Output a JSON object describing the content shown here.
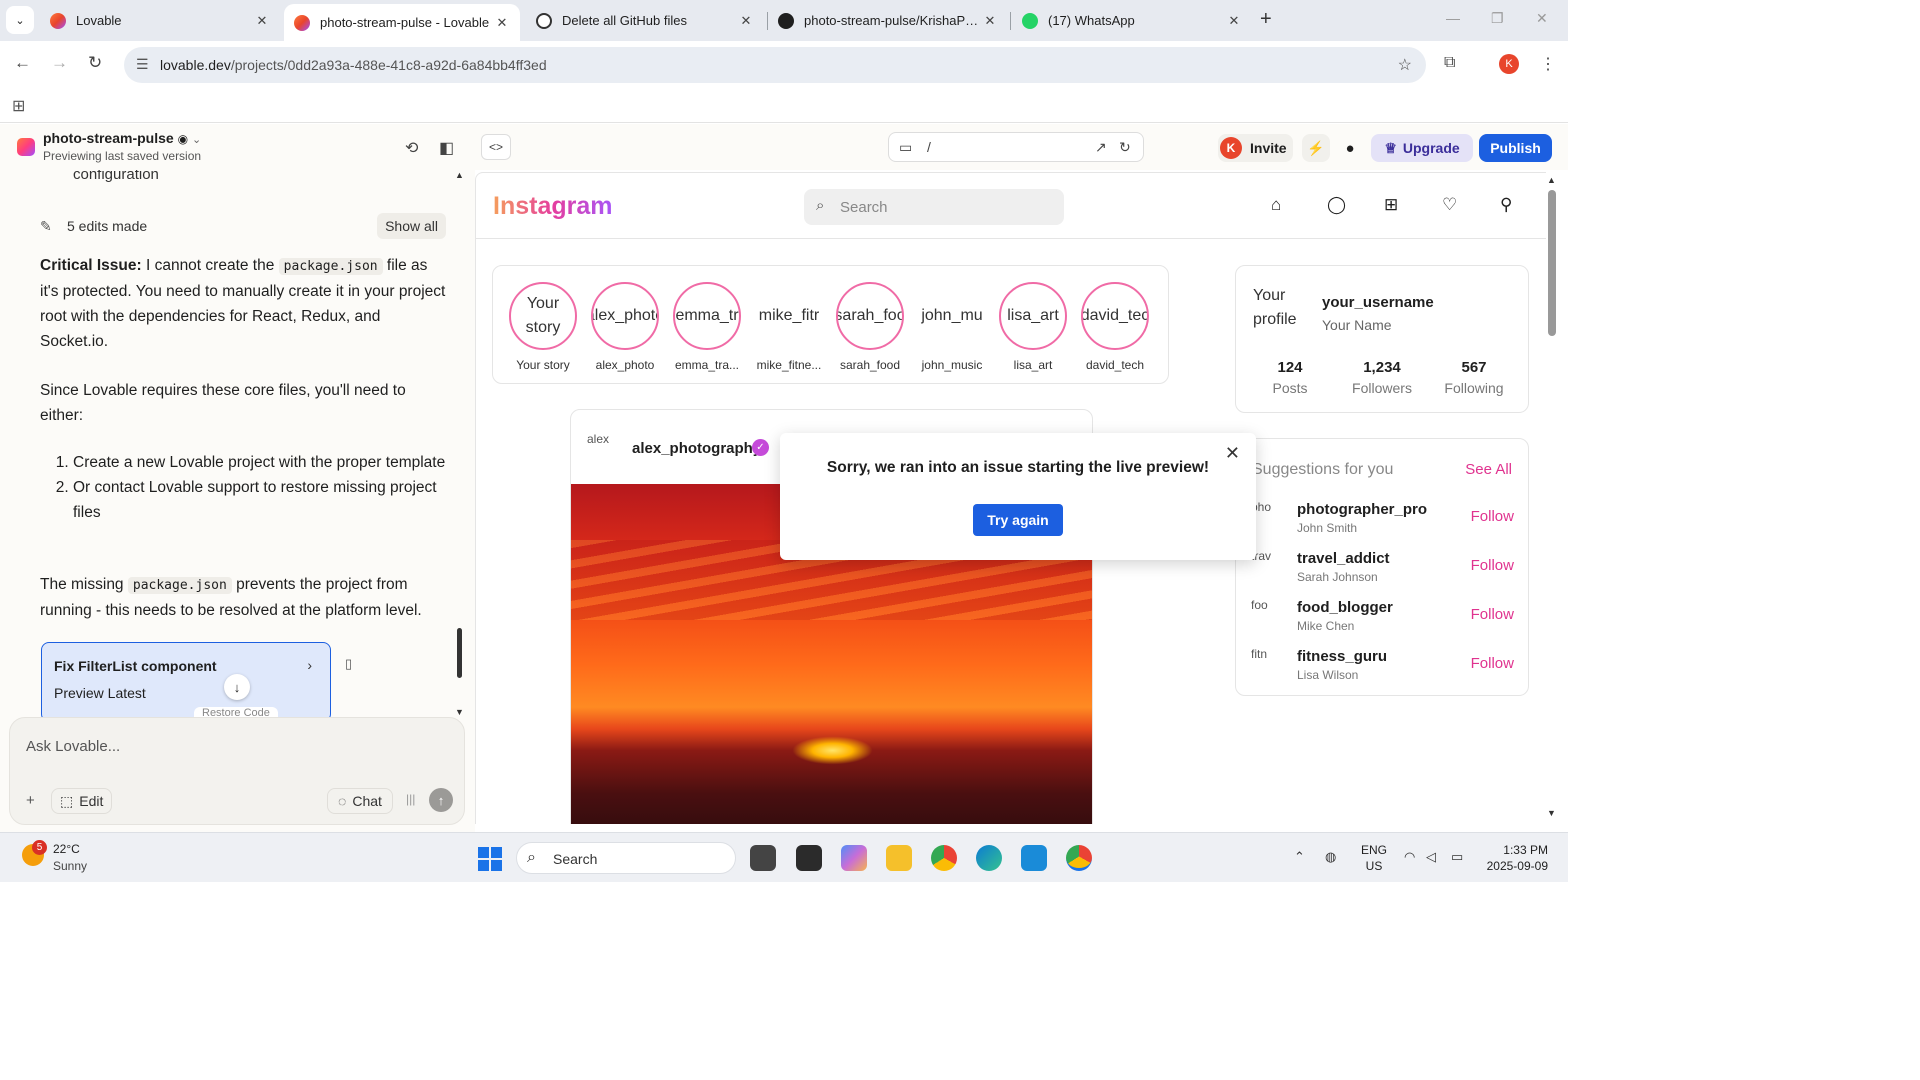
{
  "browser": {
    "tabs": [
      {
        "title": "Lovable",
        "color": "#e8452c"
      },
      {
        "title": "photo-stream-pulse - Lovable",
        "color": "#e8452c"
      },
      {
        "title": "Delete all GitHub files",
        "color": "#333333"
      },
      {
        "title": "photo-stream-pulse/KrishaPatel",
        "color": "#1f1f1f"
      },
      {
        "title": "(17) WhatsApp",
        "color": "#25d366"
      }
    ],
    "url_host": "lovable.dev",
    "url_path": "/projects/0dd2a93a-488e-41c8-a92d-6a84bb4ff3ed",
    "profile_initial": "K"
  },
  "lovable": {
    "project_name": "photo-stream-pulse",
    "subtitle": "Previewing last saved version",
    "preview_path": "/",
    "invite_label": "Invite",
    "avatar_initial": "K",
    "upgrade_label": "Upgrade",
    "publish_label": "Publish"
  },
  "chat": {
    "cut_text": "configuration",
    "edits_count": "5 edits made",
    "show_all": "Show all",
    "critical_label": "Critical Issue:",
    "critical_text_1": " I cannot create the ",
    "code_package": "package.json",
    "critical_text_2": " file as it's protected. You need to manually create it in your project root with the dependencies for React, Redux, and Socket.io.",
    "since_text": "Since Lovable requires these core files, you'll need to either:",
    "options": [
      "Create a new Lovable project with the proper template",
      "Or contact Lovable support to restore missing project files"
    ],
    "missing_1": "The missing ",
    "missing_2": " prevents the project from running - this needs to be resolved at the platform level.",
    "card_title": "Fix FilterList component",
    "card_sub": "Preview Latest",
    "card_actions": "Restore   Code",
    "ask_placeholder": "Ask Lovable...",
    "edit_label": "Edit",
    "chat_label": "Chat"
  },
  "instagram": {
    "logo": "Instagram",
    "search_placeholder": "Search",
    "stories": [
      {
        "alt": "Your story",
        "name": "Your story",
        "ring": false
      },
      {
        "alt": "alex_photo",
        "name": "alex_photo",
        "ring": true
      },
      {
        "alt": "emma_tr",
        "name": "emma_tra...",
        "ring": true
      },
      {
        "alt": "mike_fitr",
        "name": "mike_fitne...",
        "ring": false
      },
      {
        "alt": "sarah_foo",
        "name": "sarah_food",
        "ring": true
      },
      {
        "alt": "john_mu",
        "name": "john_music",
        "ring": false
      },
      {
        "alt": "lisa_art",
        "name": "lisa_art",
        "ring": true
      },
      {
        "alt": "david_tec",
        "name": "david_tech",
        "ring": true
      }
    ],
    "post": {
      "avatar_alt": "alex",
      "username": "alex_photography"
    },
    "profile": {
      "pic_alt": "Your profile",
      "username": "your_username",
      "real_name": "Your Name",
      "stats": [
        {
          "value": "124",
          "label": "Posts"
        },
        {
          "value": "1,234",
          "label": "Followers"
        },
        {
          "value": "567",
          "label": "Following"
        }
      ]
    },
    "suggestions": {
      "heading": "Suggestions for you",
      "see_all": "See All",
      "follow_label": "Follow",
      "items": [
        {
          "alt": "pho",
          "username": "photographer_pro",
          "real": "John Smith"
        },
        {
          "alt": "trav",
          "username": "travel_addict",
          "real": "Sarah Johnson"
        },
        {
          "alt": "foo",
          "username": "food_blogger",
          "real": "Mike Chen"
        },
        {
          "alt": "fitn",
          "username": "fitness_guru",
          "real": "Lisa Wilson"
        }
      ]
    },
    "error": {
      "message": "Sorry, we ran into an issue starting the live preview!",
      "button": "Try again"
    }
  },
  "taskbar": {
    "weather_badge": "5",
    "temp": "22°C",
    "condition": "Sunny",
    "search": "Search",
    "lang1": "ENG",
    "lang2": "US",
    "time": "1:33 PM",
    "date": "2025-09-09"
  }
}
